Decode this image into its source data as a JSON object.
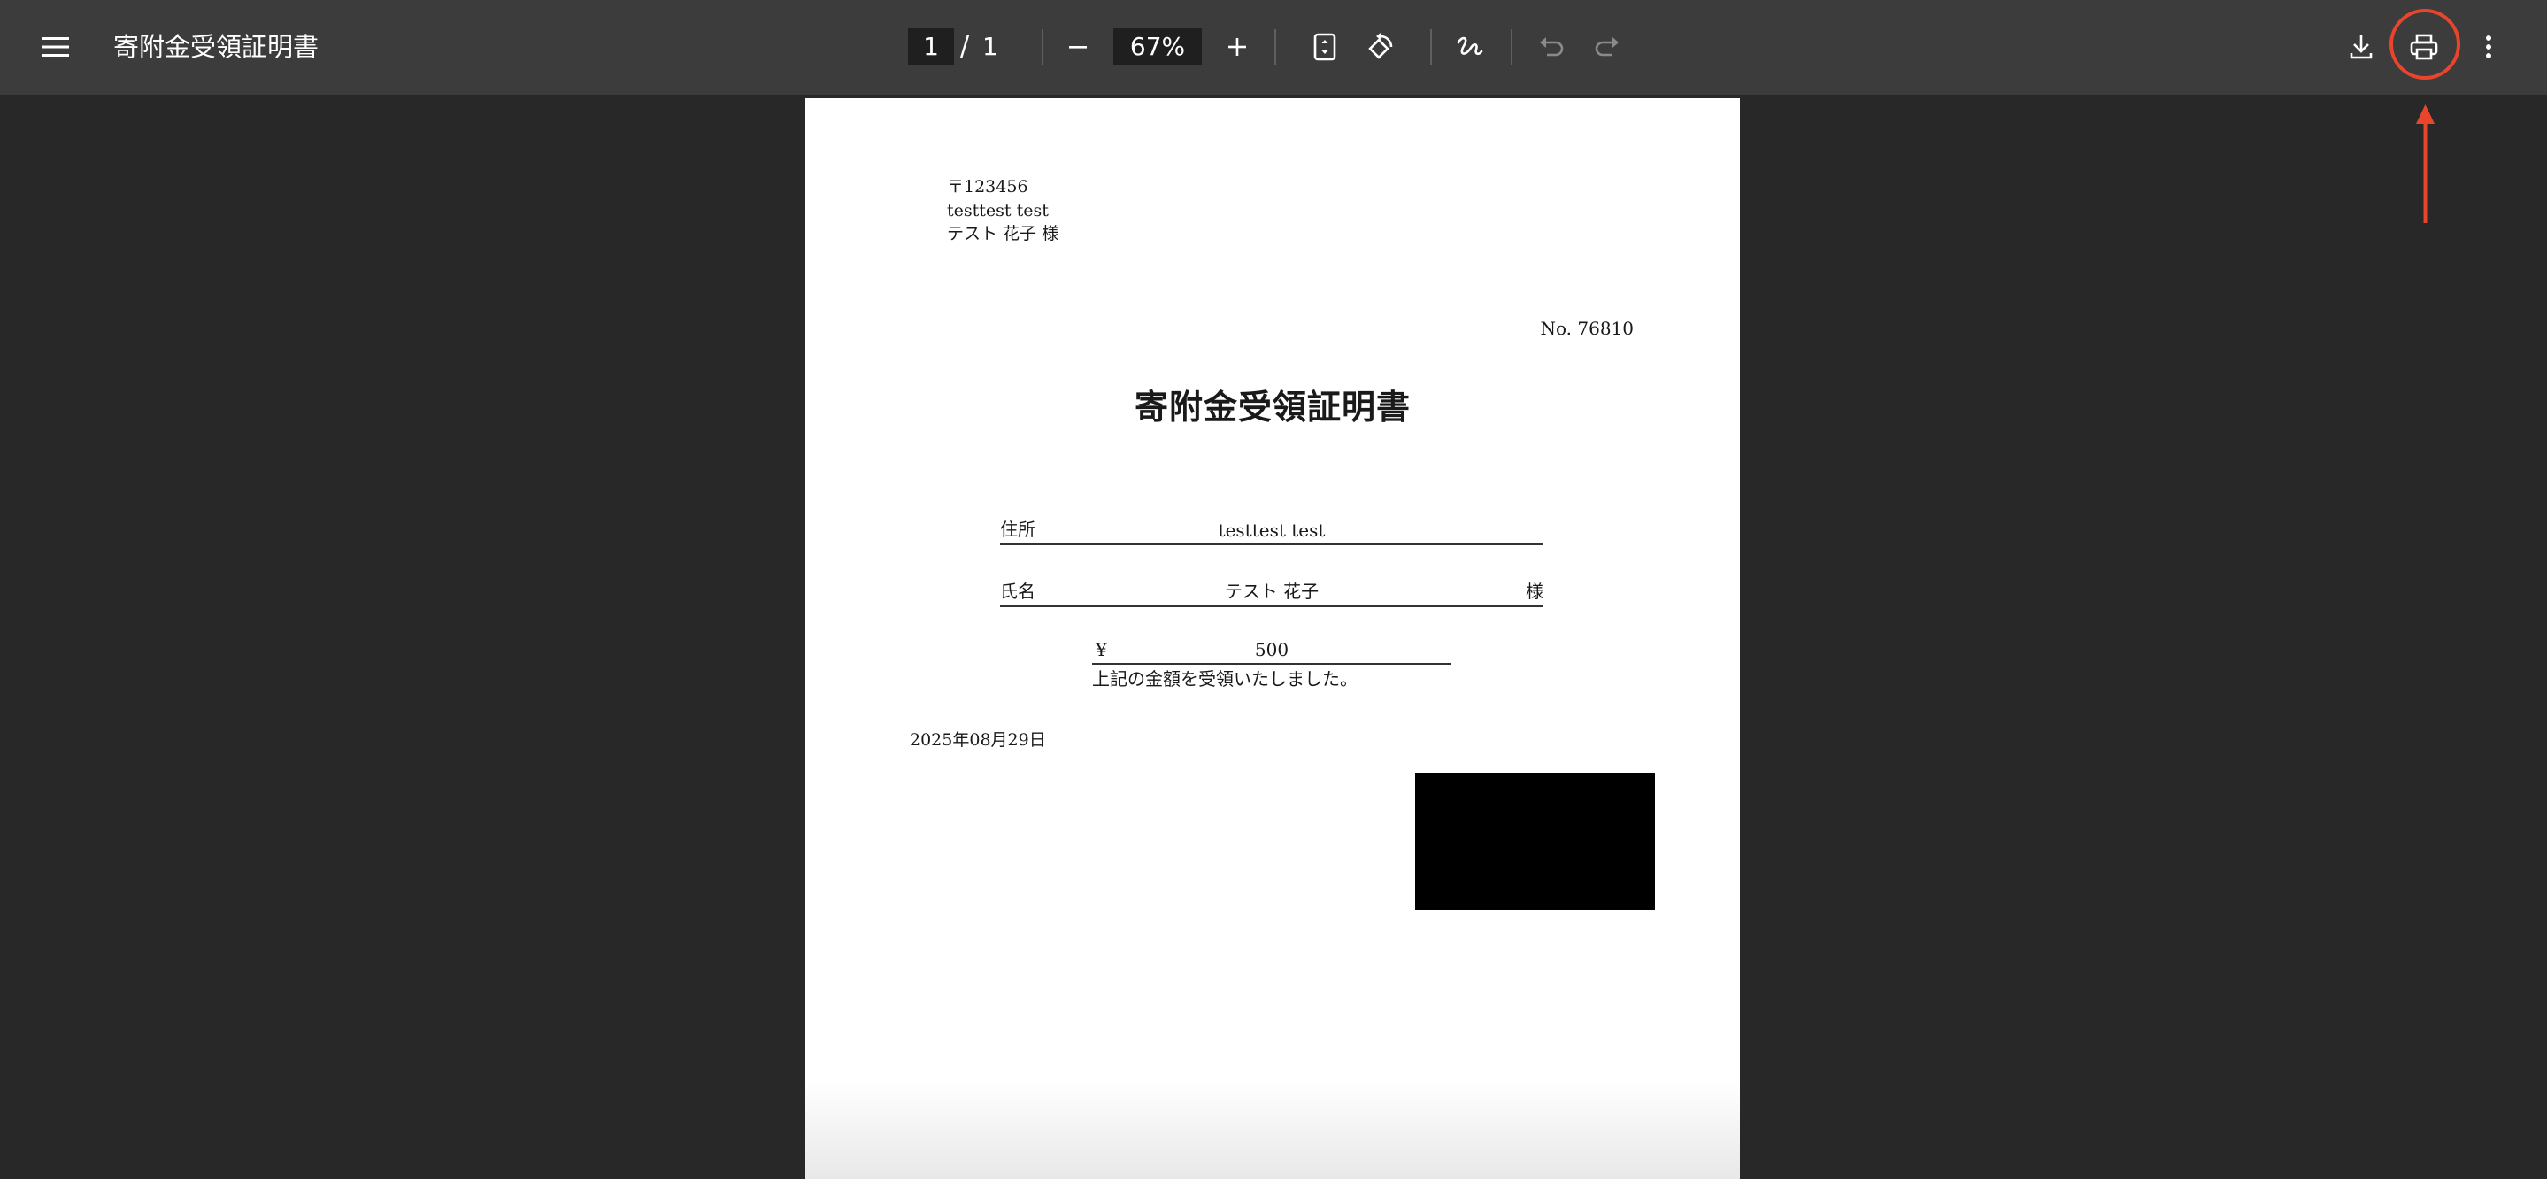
{
  "toolbar": {
    "title": "寄附金受領証明書",
    "current_page": "1",
    "page_separator": "/",
    "total_pages": "1",
    "zoom": "67%",
    "icons": {
      "menu": "menu-icon",
      "zoom_out": "minus-icon",
      "zoom_in": "plus-icon",
      "fit_page": "fit-to-page-icon",
      "rotate": "rotate-icon",
      "annotate": "draw-icon",
      "undo": "undo-icon",
      "redo": "redo-icon",
      "download": "download-icon",
      "print": "print-icon",
      "more": "more-vertical-icon"
    }
  },
  "document": {
    "postal_code": "〒123456",
    "address_line": "testtest test",
    "recipient_line": "テスト 花子 様",
    "receipt_no": "No. 76810",
    "heading": "寄附金受領証明書",
    "address_label": "住所",
    "address_value": "testtest test",
    "name_label": "氏名",
    "name_value": "テスト 花子",
    "name_suffix": "様",
    "currency_symbol": "¥",
    "amount": "500",
    "received_text": "上記の金額を受領いたしました。",
    "date": "2025年08月29日"
  },
  "colors": {
    "toolbar_bg": "#3c3c3c",
    "viewer_bg": "#282828",
    "annotation": "#e8452c"
  }
}
